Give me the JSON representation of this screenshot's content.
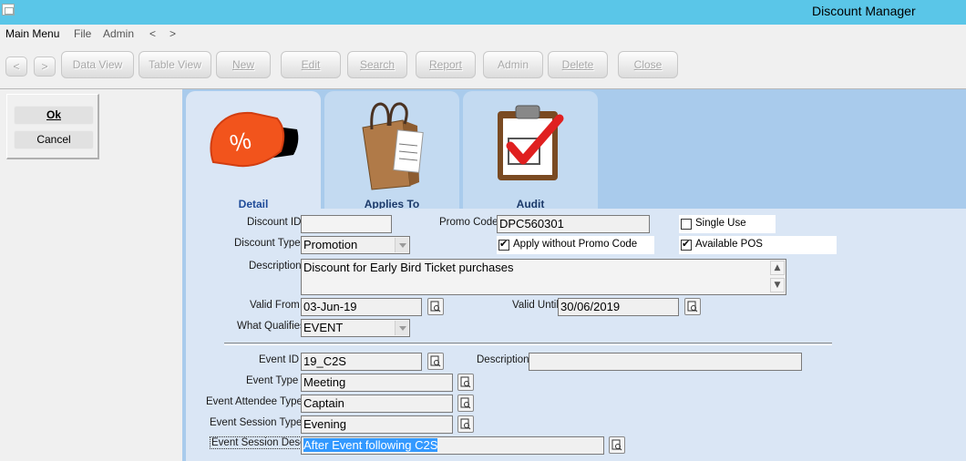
{
  "window": {
    "title": "Discount Manager"
  },
  "menu": {
    "main": "Main Menu",
    "file": "File",
    "admin": "Admin",
    "back": "<",
    "forward": ">"
  },
  "toolbar": {
    "prev": "<",
    "next": ">",
    "data_view": "Data View",
    "table_view": "Table View",
    "new": "New",
    "edit": "Edit",
    "search": "Search",
    "report": "Report",
    "admin": "Admin",
    "delete": "Delete",
    "close": "Close"
  },
  "actions": {
    "ok": "Ok",
    "cancel": "Cancel"
  },
  "tabs": [
    {
      "label": "Detail",
      "icon": "percent-ticket-icon",
      "active": true
    },
    {
      "label": "Applies To",
      "icon": "shopping-bag-icon",
      "active": false
    },
    {
      "label": "Audit",
      "icon": "clipboard-check-icon",
      "active": false
    }
  ],
  "form": {
    "discount_id": {
      "label": "Discount ID",
      "value": ""
    },
    "promo_code": {
      "label": "Promo Code",
      "value": "DPC560301"
    },
    "single_use": {
      "label": "Single Use",
      "checked": false
    },
    "discount_type": {
      "label": "Discount Type",
      "value": "Promotion"
    },
    "apply_without_promo": {
      "label": "Apply without Promo Code",
      "checked": true
    },
    "available_pos": {
      "label": "Available POS",
      "checked": true
    },
    "description": {
      "label": "Description",
      "value": "Discount for Early Bird Ticket purchases"
    },
    "valid_from": {
      "label": "Valid From",
      "value": "03-Jun-19"
    },
    "valid_until": {
      "label": "Valid Until",
      "value": "30/06/2019"
    },
    "what_qualifies": {
      "label": "What Qualifies",
      "value": "EVENT"
    },
    "event_id": {
      "label": "Event ID",
      "value": "19_C2S"
    },
    "event_description": {
      "label": "Description",
      "value": ""
    },
    "event_type": {
      "label": "Event Type",
      "value": "Meeting"
    },
    "event_attendee_type": {
      "label": "Event Attendee Type",
      "value": "Captain"
    },
    "event_session_type": {
      "label": "Event Session Type",
      "value": "Evening"
    },
    "event_session_desc": {
      "label": "Event Session Desc",
      "value": "After Event following C2S"
    }
  },
  "colors": {
    "titlebar": "#5ac6e8",
    "content_bg": "#a9cbec",
    "form_bg": "#dae6f5",
    "selection": "#3399ff"
  }
}
